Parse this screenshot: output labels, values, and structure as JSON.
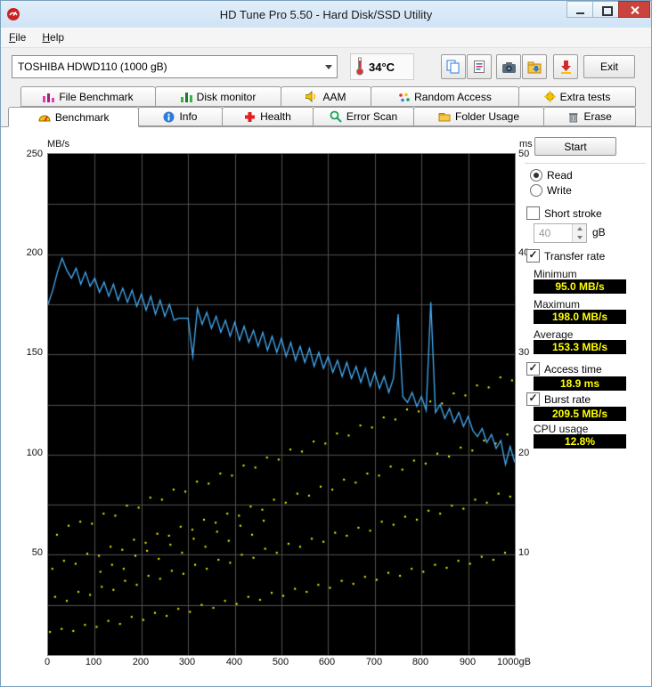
{
  "window": {
    "title": "HD Tune Pro 5.50 - Hard Disk/SSD Utility"
  },
  "menu": {
    "items": [
      {
        "label": "File"
      },
      {
        "label": "Help"
      }
    ]
  },
  "toolbar": {
    "drive_select": {
      "value": "TOSHIBA HDWD110 (1000 gB)"
    },
    "temperature": "34°C",
    "buttons": [
      {
        "name": "copy-screenshot-button",
        "icon": "copy-icon"
      },
      {
        "name": "copy-text-button",
        "icon": "copy-text-icon"
      },
      {
        "name": "screenshot-button",
        "icon": "camera-icon"
      },
      {
        "name": "save-button",
        "icon": "save-icon"
      },
      {
        "name": "download-button",
        "icon": "red-down-arrow-icon"
      }
    ],
    "exit_label": "Exit"
  },
  "tabs": {
    "row1": [
      {
        "label": "File Benchmark",
        "icon": "bar-chart-magenta-icon"
      },
      {
        "label": "Disk monitor",
        "icon": "bar-chart-green-icon"
      },
      {
        "label": "AAM",
        "icon": "speaker-icon"
      },
      {
        "label": "Random Access",
        "icon": "scatter-dots-icon"
      },
      {
        "label": "Extra tests",
        "icon": "gear-yellow-icon"
      }
    ],
    "row2": [
      {
        "label": "Benchmark",
        "icon": "gauge-icon",
        "active": true
      },
      {
        "label": "Info",
        "icon": "info-icon",
        "active": false
      },
      {
        "label": "Health",
        "icon": "health-cross-icon",
        "active": false
      },
      {
        "label": "Error Scan",
        "icon": "magnifier-icon",
        "active": false
      },
      {
        "label": "Folder Usage",
        "icon": "folder-icon",
        "active": false
      },
      {
        "label": "Erase",
        "icon": "trash-icon",
        "active": false
      }
    ]
  },
  "controls": {
    "start_label": "Start",
    "read_label": "Read",
    "write_label": "Write",
    "short_stroke_label": "Short stroke",
    "short_stroke_value": "40",
    "short_stroke_unit": "gB",
    "transfer_rate_label": "Transfer rate",
    "minimum_label": "Minimum",
    "minimum_value": "95.0 MB/s",
    "maximum_label": "Maximum",
    "maximum_value": "198.0 MB/s",
    "average_label": "Average",
    "average_value": "153.3 MB/s",
    "access_time_label": "Access time",
    "access_time_value": "18.9 ms",
    "burst_rate_label": "Burst rate",
    "burst_rate_value": "209.5 MB/s",
    "cpu_usage_label": "CPU usage",
    "cpu_usage_value": "12.8%"
  },
  "colors": {
    "value_text": "#ffff00",
    "value_bg": "#000000",
    "titlebar": "#cfe3f5"
  },
  "chart_data": {
    "type": "line+scatter",
    "title": "",
    "left_axis": {
      "title": "MB/s",
      "min": 0,
      "max": 250,
      "tick_labels": [
        "250",
        "200",
        "150",
        "100",
        "50"
      ]
    },
    "right_axis": {
      "title": "ms",
      "min": 0,
      "max": 50,
      "tick_labels": [
        "50",
        "40",
        "30",
        "20",
        "10"
      ]
    },
    "x_axis": {
      "min": 0,
      "max": 1000,
      "tick_labels": [
        "0",
        "100",
        "200",
        "300",
        "400",
        "500",
        "600",
        "700",
        "800",
        "900",
        "1000gB"
      ]
    },
    "colors": {
      "plot_bg": "#000000",
      "grid": "#4f4f4f"
    },
    "series": [
      {
        "name": "transfer_rate",
        "axis": "left",
        "color": "#46aef7",
        "x_step": 10,
        "values": [
          175,
          182,
          191,
          198,
          192,
          188,
          193,
          185,
          191,
          184,
          188,
          181,
          186,
          179,
          185,
          177,
          183,
          176,
          182,
          174,
          180,
          172,
          179,
          170,
          177,
          169,
          175,
          167,
          168,
          168,
          168,
          149,
          173,
          165,
          171,
          163,
          169,
          161,
          167,
          159,
          166,
          157,
          164,
          156,
          162,
          154,
          161,
          152,
          159,
          151,
          158,
          149,
          156,
          147,
          154,
          146,
          153,
          144,
          151,
          143,
          149,
          141,
          147,
          139,
          146,
          138,
          144,
          136,
          143,
          134,
          141,
          133,
          139,
          131,
          138,
          170,
          129,
          126,
          131,
          124,
          129,
          122,
          176,
          121,
          125,
          118,
          123,
          116,
          121,
          114,
          119,
          112,
          109,
          113,
          106,
          110,
          103,
          107,
          95,
          104,
          96
        ]
      },
      {
        "name": "access_time",
        "axis": "right",
        "color": "#ffff00",
        "points": [
          [
            4,
            2.3
          ],
          [
            15,
            5.8
          ],
          [
            9,
            8.6
          ],
          [
            19,
            12.0
          ],
          [
            29,
            2.6
          ],
          [
            40,
            5.4
          ],
          [
            34,
            9.4
          ],
          [
            44,
            12.9
          ],
          [
            54,
            2.4
          ],
          [
            65,
            6.3
          ],
          [
            59,
            9.1
          ],
          [
            69,
            13.3
          ],
          [
            79,
            3.0
          ],
          [
            90,
            6.0
          ],
          [
            84,
            10.1
          ],
          [
            94,
            13.1
          ],
          [
            104,
            2.8
          ],
          [
            115,
            6.8
          ],
          [
            109,
            9.9
          ],
          [
            119,
            14.1
          ],
          [
            112,
            8.3
          ],
          [
            129,
            3.4
          ],
          [
            140,
            6.5
          ],
          [
            134,
            10.8
          ],
          [
            144,
            13.9
          ],
          [
            137,
            9.0
          ],
          [
            154,
            3.1
          ],
          [
            165,
            7.4
          ],
          [
            159,
            10.5
          ],
          [
            169,
            14.9
          ],
          [
            162,
            8.6
          ],
          [
            179,
            3.8
          ],
          [
            190,
            7.0
          ],
          [
            184,
            11.5
          ],
          [
            194,
            14.7
          ],
          [
            187,
            9.9
          ],
          [
            204,
            3.5
          ],
          [
            215,
            7.9
          ],
          [
            209,
            11.2
          ],
          [
            219,
            15.7
          ],
          [
            212,
            10.4
          ],
          [
            229,
            4.2
          ],
          [
            240,
            7.6
          ],
          [
            234,
            12.1
          ],
          [
            244,
            15.5
          ],
          [
            237,
            9.6
          ],
          [
            254,
            3.9
          ],
          [
            265,
            8.4
          ],
          [
            259,
            11.9
          ],
          [
            269,
            16.5
          ],
          [
            262,
            11.0
          ],
          [
            279,
            4.6
          ],
          [
            290,
            8.1
          ],
          [
            284,
            12.8
          ],
          [
            294,
            16.3
          ],
          [
            287,
            10.2
          ],
          [
            304,
            4.3
          ],
          [
            315,
            9.0
          ],
          [
            309,
            12.5
          ],
          [
            319,
            17.3
          ],
          [
            312,
            11.6
          ],
          [
            329,
            5.0
          ],
          [
            340,
            8.6
          ],
          [
            334,
            13.5
          ],
          [
            344,
            17.1
          ],
          [
            337,
            10.8
          ],
          [
            354,
            4.7
          ],
          [
            365,
            9.5
          ],
          [
            359,
            13.2
          ],
          [
            369,
            18.1
          ],
          [
            362,
            12.3
          ],
          [
            379,
            5.4
          ],
          [
            390,
            9.2
          ],
          [
            384,
            14.1
          ],
          [
            394,
            17.9
          ],
          [
            387,
            11.4
          ],
          [
            404,
            5.1
          ],
          [
            415,
            10.0
          ],
          [
            409,
            13.9
          ],
          [
            419,
            18.9
          ],
          [
            412,
            12.9
          ],
          [
            429,
            5.8
          ],
          [
            440,
            9.7
          ],
          [
            434,
            14.8
          ],
          [
            444,
            18.7
          ],
          [
            437,
            12.0
          ],
          [
            454,
            5.5
          ],
          [
            465,
            10.6
          ],
          [
            459,
            14.5
          ],
          [
            469,
            19.7
          ],
          [
            462,
            13.4
          ],
          [
            479,
            6.2
          ],
          [
            490,
            10.2
          ],
          [
            484,
            15.5
          ],
          [
            494,
            19.5
          ],
          [
            504,
            5.9
          ],
          [
            515,
            11.1
          ],
          [
            509,
            15.2
          ],
          [
            519,
            20.5
          ],
          [
            529,
            6.6
          ],
          [
            540,
            10.8
          ],
          [
            534,
            16.1
          ],
          [
            544,
            20.3
          ],
          [
            554,
            6.3
          ],
          [
            565,
            11.6
          ],
          [
            559,
            15.9
          ],
          [
            569,
            21.3
          ],
          [
            579,
            7.0
          ],
          [
            590,
            11.3
          ],
          [
            584,
            16.8
          ],
          [
            594,
            21.1
          ],
          [
            604,
            6.7
          ],
          [
            615,
            12.2
          ],
          [
            609,
            16.5
          ],
          [
            619,
            22.1
          ],
          [
            629,
            7.4
          ],
          [
            640,
            11.9
          ],
          [
            634,
            17.5
          ],
          [
            644,
            21.9
          ],
          [
            654,
            7.1
          ],
          [
            665,
            12.7
          ],
          [
            659,
            17.2
          ],
          [
            669,
            22.9
          ],
          [
            679,
            7.8
          ],
          [
            690,
            12.4
          ],
          [
            684,
            18.1
          ],
          [
            694,
            22.7
          ],
          [
            704,
            7.5
          ],
          [
            715,
            13.3
          ],
          [
            709,
            17.9
          ],
          [
            719,
            23.7
          ],
          [
            729,
            8.2
          ],
          [
            740,
            13.0
          ],
          [
            734,
            18.8
          ],
          [
            744,
            23.5
          ],
          [
            754,
            7.9
          ],
          [
            765,
            13.8
          ],
          [
            759,
            18.5
          ],
          [
            769,
            24.5
          ],
          [
            779,
            8.6
          ],
          [
            790,
            13.5
          ],
          [
            784,
            19.4
          ],
          [
            794,
            24.3
          ],
          [
            804,
            8.3
          ],
          [
            815,
            14.4
          ],
          [
            809,
            19.1
          ],
          [
            819,
            25.3
          ],
          [
            829,
            9.0
          ],
          [
            840,
            14.1
          ],
          [
            834,
            20.1
          ],
          [
            844,
            25.1
          ],
          [
            854,
            8.7
          ],
          [
            865,
            14.9
          ],
          [
            859,
            19.8
          ],
          [
            869,
            26.1
          ],
          [
            879,
            9.4
          ],
          [
            890,
            14.6
          ],
          [
            884,
            20.7
          ],
          [
            894,
            25.9
          ],
          [
            904,
            9.1
          ],
          [
            915,
            15.5
          ],
          [
            909,
            20.4
          ],
          [
            919,
            26.9
          ],
          [
            929,
            9.8
          ],
          [
            940,
            15.2
          ],
          [
            934,
            21.4
          ],
          [
            944,
            26.7
          ],
          [
            954,
            9.5
          ],
          [
            965,
            16.1
          ],
          [
            959,
            21.1
          ],
          [
            969,
            27.7
          ],
          [
            979,
            10.2
          ],
          [
            990,
            15.8
          ],
          [
            984,
            22.0
          ],
          [
            994,
            27.4
          ]
        ]
      }
    ]
  }
}
